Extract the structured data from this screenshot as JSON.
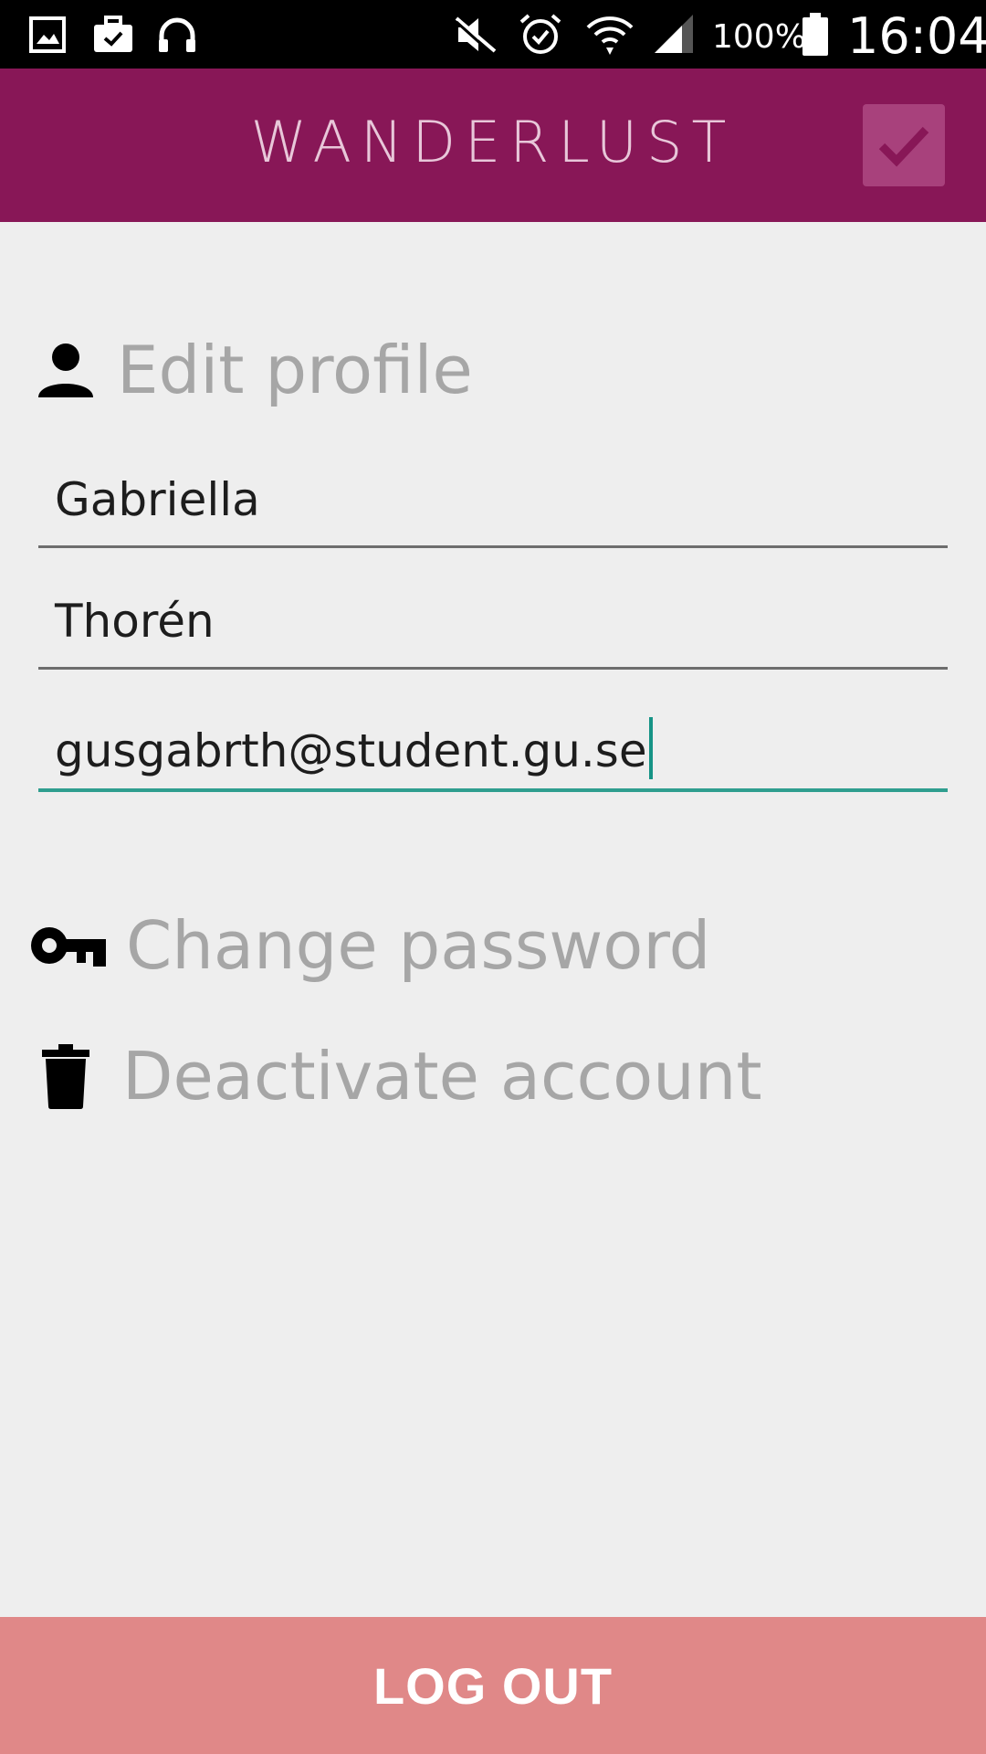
{
  "status_bar": {
    "battery_percent": "100%",
    "time": "16:04",
    "icons": [
      "gallery-icon",
      "briefcase-check-icon",
      "headphones-icon",
      "mute-icon",
      "alarm-icon",
      "wifi-icon",
      "signal-icon",
      "battery-icon"
    ]
  },
  "app_bar": {
    "brand": "WANDERLUST",
    "confirm_icon": "check-icon",
    "colors": {
      "background": "#881757",
      "confirm_button": "#a8417c"
    }
  },
  "profile": {
    "section_title": "Edit profile",
    "section_icon": "person-icon",
    "first_name": "Gabriella",
    "last_name": "Thorén",
    "email": "gusgabrth@student.gu.se"
  },
  "actions": {
    "change_password": "Change password",
    "change_password_icon": "key-icon",
    "deactivate_account": "Deactivate account",
    "deactivate_account_icon": "trash-icon"
  },
  "logout": {
    "label": "LOG OUT",
    "color": "#e08888"
  }
}
